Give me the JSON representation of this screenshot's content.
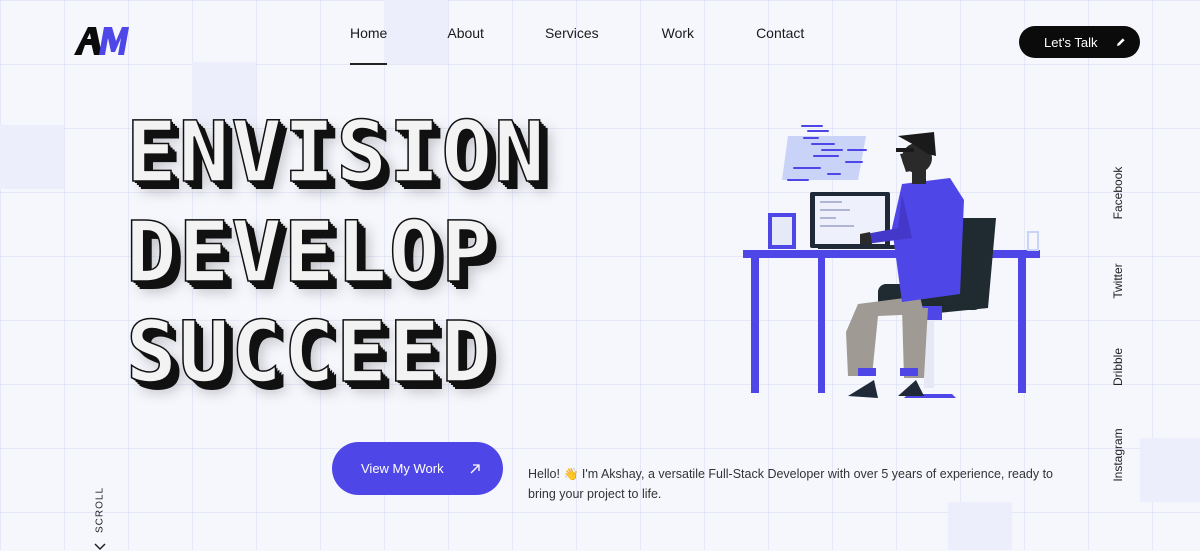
{
  "logo": {
    "text": "AM"
  },
  "nav": {
    "items": [
      {
        "label": "Home",
        "active": true
      },
      {
        "label": "About",
        "active": false
      },
      {
        "label": "Services",
        "active": false
      },
      {
        "label": "Work",
        "active": false
      },
      {
        "label": "Contact",
        "active": false
      }
    ]
  },
  "header": {
    "cta_label": "Let's Talk",
    "cta_icon": "pencil-icon"
  },
  "hero": {
    "lines": [
      "ENVISION",
      "DEVELOP",
      "SUCCEED"
    ]
  },
  "social": [
    "Facebook",
    "Twitter",
    "Dribble",
    "Instagram"
  ],
  "cta": {
    "label": "View My Work",
    "icon": "arrow-up-right-icon"
  },
  "intro": {
    "greeting": "Hello!",
    "wave": "👋",
    "text": "I'm Akshay, a versatile Full-Stack Developer with over 5 years of experience, ready to bring your project to life."
  },
  "scroll": {
    "label": "SCROLL"
  },
  "colors": {
    "accent": "#4f46e8",
    "dark": "#0b0b0b",
    "background": "#f5f7fd"
  }
}
